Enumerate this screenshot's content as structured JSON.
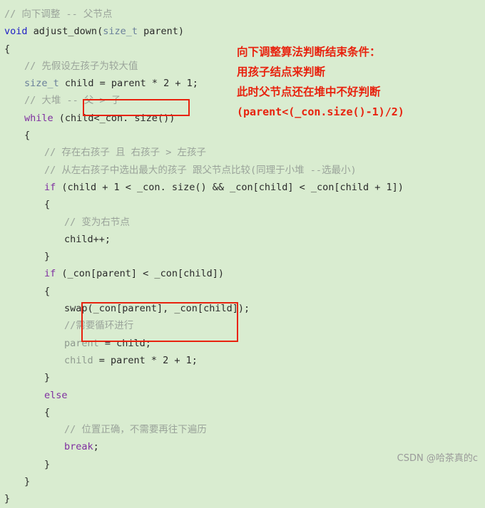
{
  "code": {
    "lines": [
      {
        "indent": 0,
        "segments": [
          {
            "cls": "cmt",
            "text": "// 向下调整 -- 父节点"
          }
        ]
      },
      {
        "indent": 0,
        "segments": [
          {
            "cls": "kw",
            "text": "void"
          },
          {
            "cls": "pl",
            "text": " "
          },
          {
            "cls": "fn",
            "text": "adjust_down"
          },
          {
            "cls": "pl",
            "text": "("
          },
          {
            "cls": "typ",
            "text": "size_t"
          },
          {
            "cls": "pl",
            "text": " parent)"
          }
        ]
      },
      {
        "indent": 0,
        "segments": [
          {
            "cls": "pl",
            "text": "{"
          }
        ]
      },
      {
        "indent": 1,
        "segments": [
          {
            "cls": "cmt",
            "text": "// 先假设左孩子为较大值"
          }
        ]
      },
      {
        "indent": 1,
        "segments": [
          {
            "cls": "typ",
            "text": "size_t"
          },
          {
            "cls": "pl",
            "text": " child = parent * 2 + 1;"
          }
        ]
      },
      {
        "indent": 1,
        "segments": [
          {
            "cls": "cmt",
            "text": "// 大堆 -- 父 > 子"
          }
        ]
      },
      {
        "indent": 1,
        "segments": [
          {
            "cls": "kw2",
            "text": "while"
          },
          {
            "cls": "pl",
            "text": " (child<_con. size())"
          }
        ]
      },
      {
        "indent": 1,
        "segments": [
          {
            "cls": "pl",
            "text": "{"
          }
        ]
      },
      {
        "indent": 2,
        "segments": [
          {
            "cls": "cmt",
            "text": "// 存在右孩子 且 右孩子 > 左孩子"
          }
        ]
      },
      {
        "indent": 2,
        "segments": [
          {
            "cls": "cmt",
            "text": "// 从左右孩子中选出最大的孩子 跟父节点比较(同理于小堆 --选最小)"
          }
        ]
      },
      {
        "indent": 2,
        "segments": [
          {
            "cls": "kw2",
            "text": "if"
          },
          {
            "cls": "pl",
            "text": " (child + 1 < _con. size() && _con[child] < _con[child + 1])"
          }
        ]
      },
      {
        "indent": 2,
        "segments": [
          {
            "cls": "pl",
            "text": "{"
          }
        ]
      },
      {
        "indent": 3,
        "segments": [
          {
            "cls": "cmt",
            "text": "// 变为右节点"
          }
        ]
      },
      {
        "indent": 3,
        "segments": [
          {
            "cls": "pl",
            "text": "child++;"
          }
        ]
      },
      {
        "indent": 2,
        "segments": [
          {
            "cls": "pl",
            "text": "}"
          }
        ]
      },
      {
        "indent": 2,
        "segments": [
          {
            "cls": "kw2",
            "text": "if"
          },
          {
            "cls": "pl",
            "text": " (_con[parent] < _con[child])"
          }
        ]
      },
      {
        "indent": 2,
        "segments": [
          {
            "cls": "pl",
            "text": "{"
          }
        ]
      },
      {
        "indent": 3,
        "segments": [
          {
            "cls": "pl",
            "text": "swap(_con[parent], _con[child]);"
          }
        ]
      },
      {
        "indent": 3,
        "segments": [
          {
            "cls": "cmt",
            "text": "//需要循环进行"
          }
        ]
      },
      {
        "indent": 3,
        "segments": [
          {
            "cls": "var",
            "text": "parent"
          },
          {
            "cls": "pl",
            "text": " = child;"
          }
        ]
      },
      {
        "indent": 3,
        "segments": [
          {
            "cls": "var",
            "text": "child"
          },
          {
            "cls": "pl",
            "text": " = parent * 2 + 1;"
          }
        ]
      },
      {
        "indent": 2,
        "segments": [
          {
            "cls": "pl",
            "text": "}"
          }
        ]
      },
      {
        "indent": 2,
        "segments": [
          {
            "cls": "kw2",
            "text": "else"
          }
        ]
      },
      {
        "indent": 2,
        "segments": [
          {
            "cls": "pl",
            "text": "{"
          }
        ]
      },
      {
        "indent": 3,
        "segments": [
          {
            "cls": "cmt",
            "text": "// 位置正确，不需要再往下遍历"
          }
        ]
      },
      {
        "indent": 3,
        "segments": [
          {
            "cls": "kw2",
            "text": "break"
          },
          {
            "cls": "pl",
            "text": ";"
          }
        ]
      },
      {
        "indent": 2,
        "segments": [
          {
            "cls": "pl",
            "text": "}"
          }
        ]
      },
      {
        "indent": 1,
        "segments": [
          {
            "cls": "pl",
            "text": "}"
          }
        ]
      },
      {
        "indent": 0,
        "segments": [
          {
            "cls": "pl",
            "text": "}"
          }
        ]
      }
    ]
  },
  "annotation": {
    "lines": [
      "向下调整算法判断结束条件：",
      "用孩子结点来判断",
      "此时父节点还在堆中不好判断",
      "(parent<(_con.size()-1)/2)"
    ],
    "color": "#e8220e"
  },
  "watermark": {
    "text": "CSDN @哈茶真的c"
  }
}
